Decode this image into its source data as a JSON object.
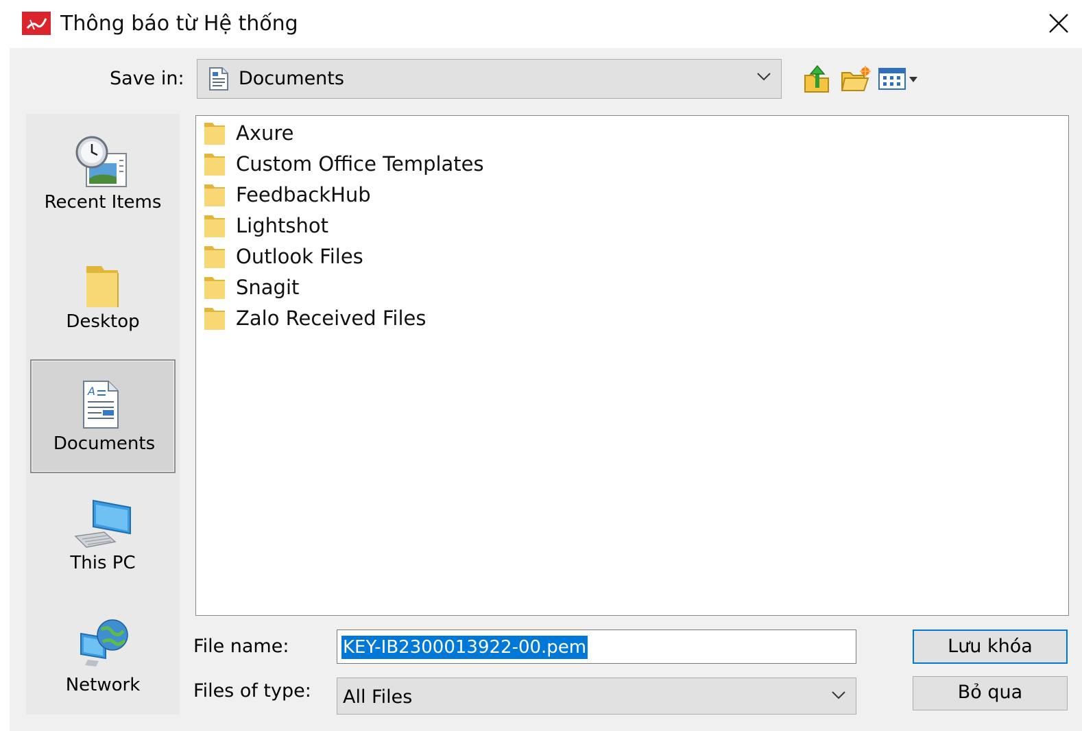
{
  "window": {
    "title": "Thông báo từ Hệ thống",
    "close_glyph": "✕"
  },
  "save_in": {
    "label": "Save in:",
    "value": "Documents"
  },
  "toolbar": {
    "icons": [
      "up-folder-icon",
      "new-folder-icon",
      "view-menu-icon"
    ]
  },
  "places": [
    {
      "label": "Recent Items",
      "icon": "recent-items-icon"
    },
    {
      "label": "Desktop",
      "icon": "desktop-folder-icon"
    },
    {
      "label": "Documents",
      "icon": "documents-icon",
      "selected": true
    },
    {
      "label": "This PC",
      "icon": "computer-icon"
    },
    {
      "label": "Network",
      "icon": "network-icon"
    }
  ],
  "files": [
    "Axure",
    "Custom Office Templates",
    "FeedbackHub",
    "Lightshot",
    "Outlook Files",
    "Snagit",
    "Zalo Received Files"
  ],
  "file_name": {
    "label": "File name:",
    "value": "KEY-IB2300013922-00.pem"
  },
  "file_type": {
    "label": "Files of type:",
    "value": "All Files"
  },
  "buttons": {
    "save": "Lưu khóa",
    "cancel": "Bỏ qua"
  },
  "colors": {
    "selection": "#0078d7",
    "dialog_bg": "#f0f0f0",
    "folder": "#f8d775",
    "app_icon": "#d9252b"
  }
}
